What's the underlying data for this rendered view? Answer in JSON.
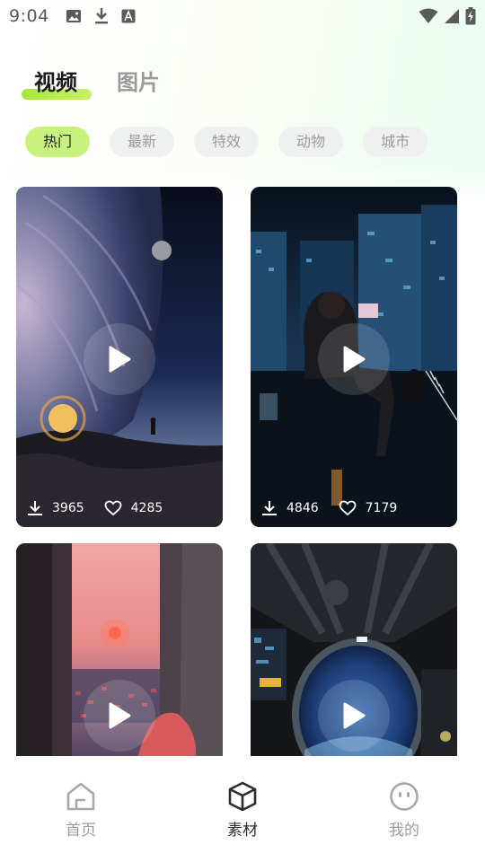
{
  "status_bar": {
    "time": "9:04",
    "left_icons": [
      "image-icon",
      "download-icon",
      "text-a-icon"
    ],
    "right_icons": [
      "wifi-icon",
      "signal-icon",
      "battery-charging-icon"
    ]
  },
  "top_tabs": [
    {
      "label": "视频",
      "active": true
    },
    {
      "label": "图片",
      "active": false
    }
  ],
  "categories": [
    {
      "label": "热门",
      "active": true
    },
    {
      "label": "最新",
      "active": false
    },
    {
      "label": "特效",
      "active": false
    },
    {
      "label": "动物",
      "active": false
    },
    {
      "label": "城市",
      "active": false
    }
  ],
  "videos": [
    {
      "downloads": "3965",
      "likes": "4285",
      "scene": "planet-horizon-astronaut"
    },
    {
      "downloads": "4846",
      "likes": "7179",
      "scene": "girl-on-rooftop-night-city"
    },
    {
      "downloads": "",
      "likes": "",
      "scene": "sunset-city-girl"
    },
    {
      "downloads": "",
      "likes": "",
      "scene": "spaceship-porthole-earth"
    }
  ],
  "bottom_nav": [
    {
      "label": "首页",
      "icon": "home-icon",
      "active": false
    },
    {
      "label": "素材",
      "icon": "cube-icon",
      "active": true
    },
    {
      "label": "我的",
      "icon": "smile-face-icon",
      "active": false
    }
  ],
  "colors": {
    "accent": "#c8f27e",
    "chip_bg": "#eef1ef",
    "text_muted": "#9a9a9a"
  }
}
